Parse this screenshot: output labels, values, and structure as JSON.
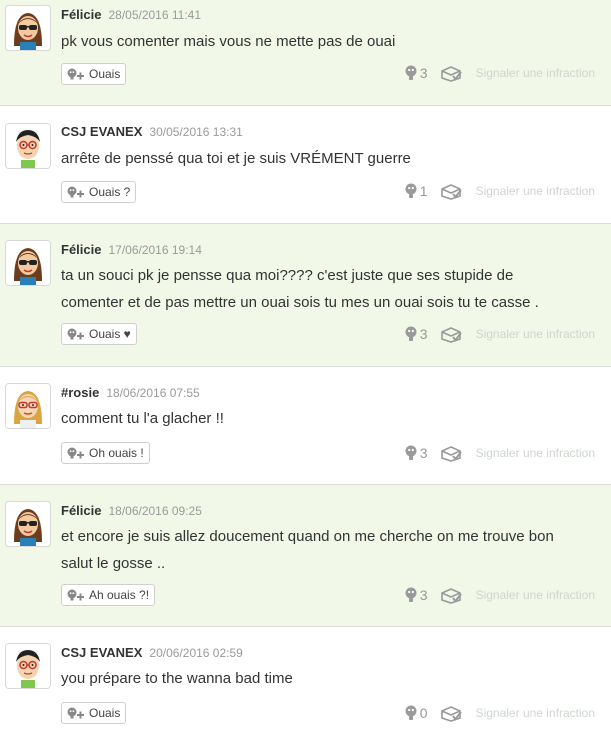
{
  "comments": [
    {
      "author": "Félicie",
      "date": "28/05/2016 11:41",
      "lines": [
        "pk vous comenter mais vous ne mette pas de ouai"
      ],
      "yeah_label": "Ouais",
      "yeah_count": "3",
      "report_label": "Signaler une infraction",
      "highlight": true,
      "avatar": "female-dark-sunglasses"
    },
    {
      "author": "CSJ EVANEX",
      "date": "30/05/2016 13:31",
      "lines": [
        "arrête de penssé qua toi et je suis VRÉMENT guerre"
      ],
      "yeah_label": "Ouais ?",
      "yeah_count": "1",
      "report_label": "Signaler une infraction",
      "highlight": false,
      "avatar": "male-glasses"
    },
    {
      "author": "Félicie",
      "date": "17/06/2016 19:14",
      "lines": [
        "ta un souci pk je pensse qua moi???? c'est juste que ses stupide de",
        "comenter et de pas mettre un ouai sois tu mes un ouai sois tu te casse ."
      ],
      "yeah_label": "Ouais ♥",
      "yeah_count": "3",
      "report_label": "Signaler une infraction",
      "highlight": true,
      "avatar": "female-dark-sunglasses"
    },
    {
      "author": "#rosie",
      "date": "18/06/2016 07:55",
      "lines": [
        "comment tu l'a glacher !!"
      ],
      "yeah_label": "Oh ouais !",
      "yeah_count": "3",
      "report_label": "Signaler une infraction",
      "highlight": false,
      "avatar": "female-blonde-red-glasses"
    },
    {
      "author": "Félicie",
      "date": "18/06/2016 09:25",
      "lines": [
        "et encore je suis allez doucement quand on me cherche on me trouve bon",
        "salut le gosse .."
      ],
      "yeah_label": "Ah ouais ?!",
      "yeah_count": "3",
      "report_label": "Signaler une infraction",
      "highlight": true,
      "avatar": "female-dark-sunglasses"
    },
    {
      "author": "CSJ EVANEX",
      "date": "20/06/2016 02:59",
      "lines": [
        "you prépare to the wanna bad time"
      ],
      "yeah_label": "Ouais",
      "yeah_count": "0",
      "report_label": "Signaler une infraction",
      "highlight": false,
      "avatar": "male-glasses"
    }
  ],
  "icons": {
    "yeah_button": "add-yeah-icon",
    "yeah_count": "yeah-face-icon",
    "spoiler": "spoiler-icon"
  },
  "colors": {
    "highlight_bg": "#f1f8e7",
    "normal_bg": "#ffffff",
    "author": "#333333",
    "date": "#9a9a9a",
    "report_link": "#cfd5cf"
  }
}
